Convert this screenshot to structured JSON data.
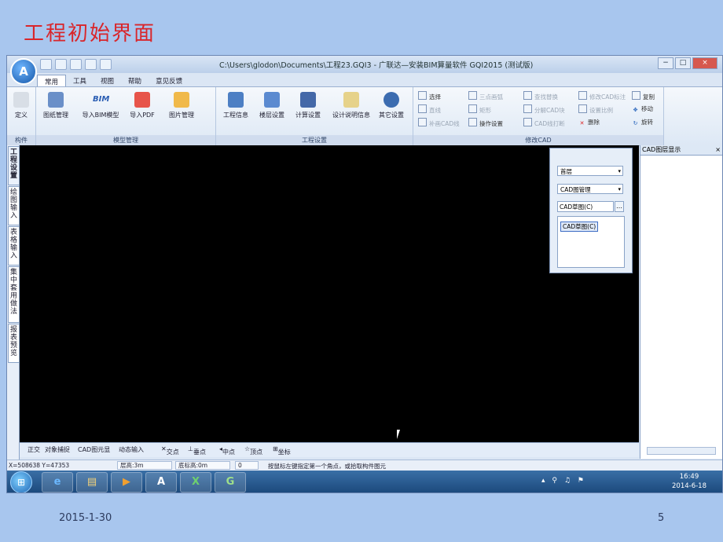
{
  "slide": {
    "title": "工程初始界面",
    "date": "2015-1-30",
    "page": "5"
  },
  "window": {
    "title": "C:\\Users\\glodon\\Documents\\工程23.GQI3 - 广联达—安装BIM算量软件 GQI2015 (测试版)",
    "logo": "A",
    "min": "−",
    "max": "□",
    "close": "×"
  },
  "tabs": [
    "常用",
    "工具",
    "视图",
    "帮助",
    "意见反馈"
  ],
  "ribbon": {
    "component": {
      "btn": "定义",
      "label": "构件"
    },
    "model": {
      "label": "模型管理",
      "buttons": [
        "图纸管理",
        "导入BIM模型",
        "导入PDF",
        "图片管理"
      ],
      "bim_icon": "BIM"
    },
    "project": {
      "label": "工程设置",
      "buttons": [
        "工程信息",
        "楼层设置",
        "计算设置",
        "设计说明信息",
        "其它设置"
      ]
    },
    "cad": {
      "label": "修改CAD",
      "items": [
        "选择",
        "直线",
        "补画CAD线",
        "三点画弧",
        "矩形",
        "操作设置",
        "查找替换",
        "分解CAD块",
        "CAD线打断",
        "修改CAD标注",
        "设置比例",
        "删除",
        "复制",
        "移动",
        "旋转"
      ]
    }
  },
  "sidebar": [
    "工程设置",
    "绘图输入",
    "表格输入",
    "集中套用做法",
    "报表预览"
  ],
  "float_panel": {
    "floor": "首层",
    "cad_mgr": "CAD图管理",
    "draft": "CAD草图(C)",
    "list_item": "CAD草图(C)",
    "browse": "…"
  },
  "right_panel": {
    "title": "CAD图层显示",
    "close": "×"
  },
  "snapbar": [
    "正交",
    "对象捕捉",
    "CAD图元显",
    "动态输入",
    "交点",
    "垂点",
    "中点",
    "顶点",
    "坐标"
  ],
  "status": {
    "coords": "X=508638 Y=47353",
    "floor_h": "层高:3m",
    "base_h": "底标高:0m",
    "zero": "0",
    "hint": "按鼠标左键指定第一个角点，或拾取构件图元"
  },
  "taskbar": {
    "start": "⊞",
    "apps": [
      "e",
      "▤",
      "▶",
      "A",
      "X",
      "G"
    ],
    "tray": "▴ ⚲ ♫ ⚑",
    "time": "16:49",
    "date": "2014-6-18"
  }
}
